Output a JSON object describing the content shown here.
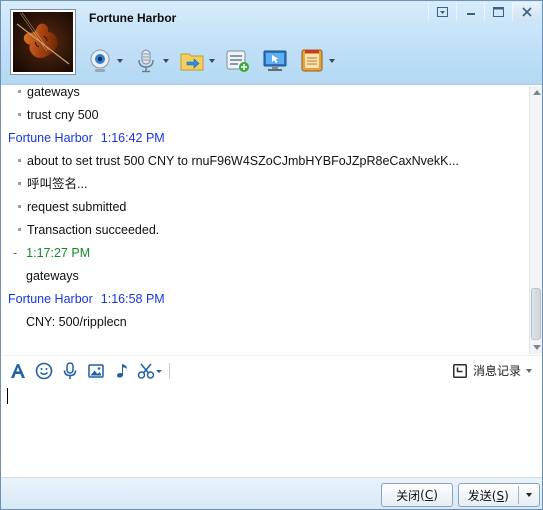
{
  "window": {
    "contact_name": "Fortune Harbor",
    "controls": [
      "menu-icon",
      "minimize-icon",
      "maximize-icon",
      "close-icon"
    ]
  },
  "toolbar": {
    "items": [
      "webcam-icon",
      "microphone-icon",
      "send-file-icon",
      "add-note-icon",
      "remote-desktop-icon",
      "app-icon"
    ]
  },
  "chat": {
    "lines": [
      {
        "kind": "msg",
        "text": "gateways"
      },
      {
        "kind": "msg",
        "text": "trust cny 500"
      },
      {
        "kind": "sender",
        "name": "Fortune Harbor",
        "time": "1:16:42 PM"
      },
      {
        "kind": "msg",
        "text": "about to set trust 500 CNY to rnuF96W4SZoCJmbHYBFoJZpR8eCaxNvekK..."
      },
      {
        "kind": "msg",
        "text": "呼叫签名..."
      },
      {
        "kind": "msg",
        "text": "request submitted"
      },
      {
        "kind": "msg",
        "text": "Transaction succeeded."
      },
      {
        "kind": "self",
        "dash": "-",
        "time": "1:17:27 PM"
      },
      {
        "kind": "plain",
        "text": "gateways"
      },
      {
        "kind": "sender",
        "name": "Fortune Harbor",
        "time": "1:16:58 PM"
      },
      {
        "kind": "plain",
        "text": "CNY: 500/ripplecn"
      }
    ]
  },
  "format_bar": {
    "tools": [
      "font-icon",
      "emoji-icon",
      "voice-icon",
      "image-icon",
      "music-icon",
      "screenshot-scissors-icon"
    ],
    "history_label": "消息记录"
  },
  "input": {
    "value": ""
  },
  "buttons": {
    "close_label": "关闭",
    "close_key": "C",
    "send_label": "发送",
    "send_key": "S"
  },
  "colors": {
    "sender": "#1a36e0",
    "self": "#138a2a",
    "header": "#c0e0f7"
  }
}
